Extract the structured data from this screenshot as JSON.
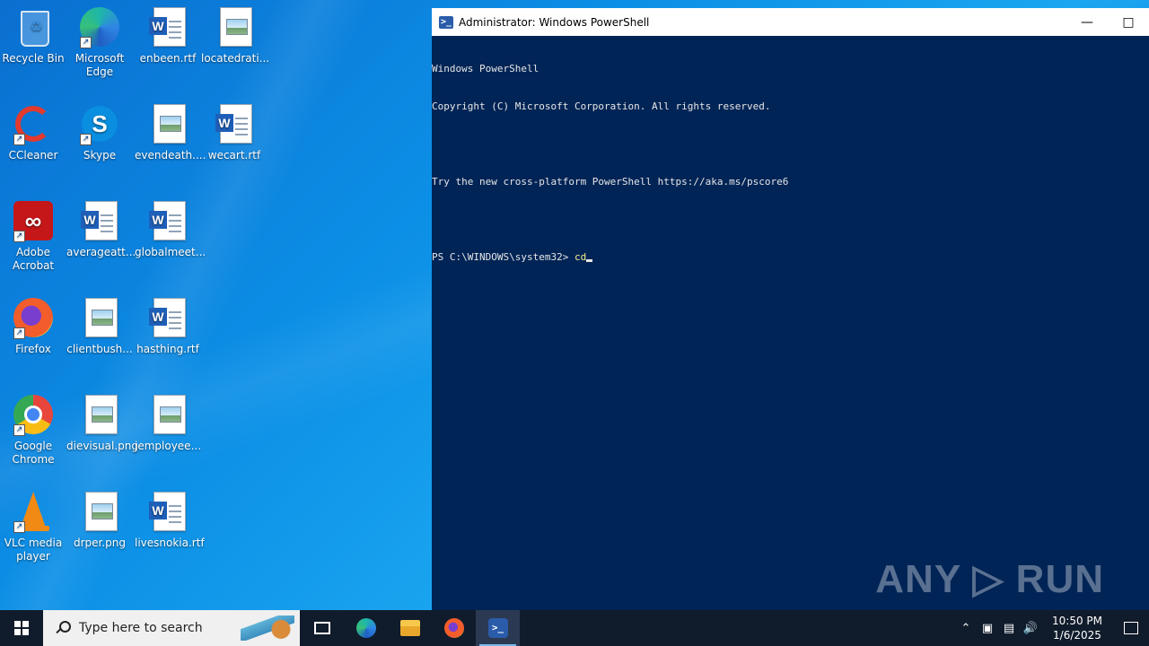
{
  "desktop": {
    "icons": [
      {
        "name": "recycle-bin",
        "label": "Recycle Bin",
        "kind": "recycle"
      },
      {
        "name": "microsoft-edge",
        "label": "Microsoft Edge",
        "kind": "edge"
      },
      {
        "name": "enbeen",
        "label": "enbeen.rtf",
        "kind": "word"
      },
      {
        "name": "locatedrati",
        "label": "locatedrati...",
        "kind": "image"
      },
      {
        "name": "ccleaner",
        "label": "CCleaner",
        "kind": "ccleaner"
      },
      {
        "name": "skype",
        "label": "Skype",
        "kind": "skype"
      },
      {
        "name": "evendeath",
        "label": "evendeath....",
        "kind": "image"
      },
      {
        "name": "wecart",
        "label": "wecart.rtf",
        "kind": "word"
      },
      {
        "name": "adobe-acrobat",
        "label": "Adobe Acrobat",
        "kind": "acrobat"
      },
      {
        "name": "averageatt",
        "label": "averageatt...",
        "kind": "word"
      },
      {
        "name": "globalmeet",
        "label": "globalmeet...",
        "kind": "word"
      },
      {
        "name": "firefox",
        "label": "Firefox",
        "kind": "firefox"
      },
      {
        "name": "clientbush",
        "label": "clientbush...",
        "kind": "image"
      },
      {
        "name": "hasthing",
        "label": "hasthing.rtf",
        "kind": "word"
      },
      {
        "name": "google-chrome",
        "label": "Google Chrome",
        "kind": "chrome"
      },
      {
        "name": "dievisual",
        "label": "dievisual.png",
        "kind": "image"
      },
      {
        "name": "jemployee",
        "label": "jemployee...",
        "kind": "image"
      },
      {
        "name": "vlc",
        "label": "VLC media player",
        "kind": "vlc"
      },
      {
        "name": "drper",
        "label": "drper.png",
        "kind": "image"
      },
      {
        "name": "livesnokia",
        "label": "livesnokia.rtf",
        "kind": "word"
      }
    ]
  },
  "powershell": {
    "title": "Administrator: Windows PowerShell",
    "lines": [
      "Windows PowerShell",
      "Copyright (C) Microsoft Corporation. All rights reserved.",
      "",
      "Try the new cross-platform PowerShell https://aka.ms/pscore6",
      ""
    ],
    "prompt": "PS C:\\WINDOWS\\system32> ",
    "command": "cd",
    "background": "#012456"
  },
  "watermark": "ANY ▷ RUN",
  "taskbar": {
    "search_placeholder": "Type here to search",
    "time": "10:50 PM",
    "date": "1/6/2025"
  }
}
